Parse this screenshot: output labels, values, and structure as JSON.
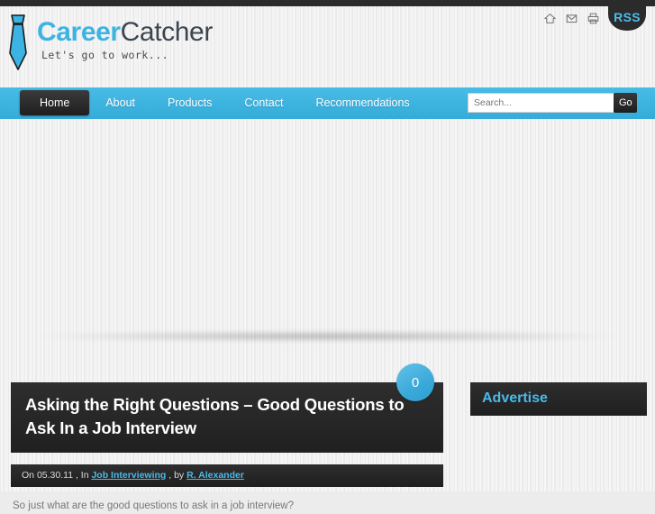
{
  "site": {
    "logo_primary": "Career",
    "logo_secondary": "Catcher",
    "tagline": "Let's go to work...",
    "tie_icon": "necktie-icon"
  },
  "header": {
    "icons": [
      {
        "name": "home-icon",
        "label": "Home"
      },
      {
        "name": "mail-icon",
        "label": "Contact"
      },
      {
        "name": "print-icon",
        "label": "Print"
      }
    ],
    "rss_label": "RSS"
  },
  "nav": {
    "items": [
      {
        "label": "Home",
        "active": true
      },
      {
        "label": "About",
        "active": false
      },
      {
        "label": "Products",
        "active": false
      },
      {
        "label": "Contact",
        "active": false
      },
      {
        "label": "Recommendations",
        "active": false
      }
    ]
  },
  "search": {
    "placeholder": "Search...",
    "value": "",
    "button_label": "Go"
  },
  "post": {
    "title": "Asking the Right Questions – Good Questions to Ask In a Job Interview",
    "comment_count": "0",
    "meta": {
      "on_prefix": "On",
      "date": "05.30.11",
      "in_prefix": ", In",
      "category": "Job Interviewing",
      "by_prefix": ", by",
      "author": "R. Alexander"
    },
    "body": "So just what are the good questions to ask in a job interview?"
  },
  "sidebar": {
    "widgets": [
      {
        "title": "Advertise"
      }
    ]
  },
  "colors": {
    "accent_blue": "#3bb3df",
    "link_blue": "#4cb9e8",
    "dark": "#262626",
    "page_bg": "#eeeeef"
  }
}
